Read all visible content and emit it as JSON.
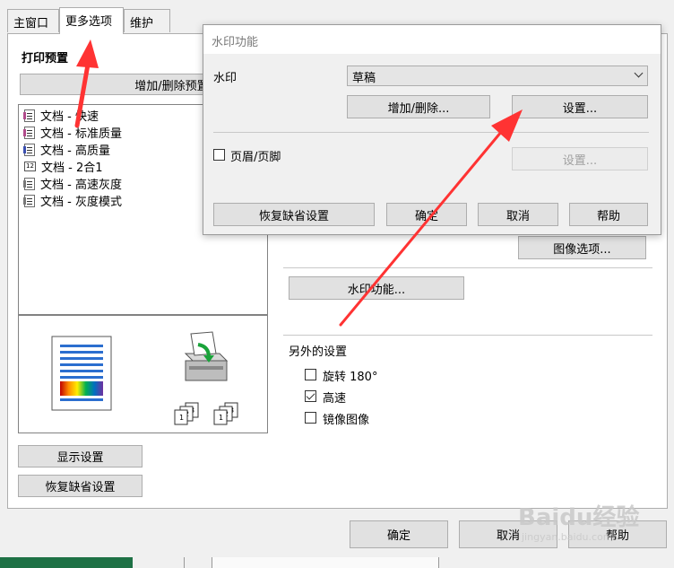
{
  "tabs": [
    "主窗口",
    "更多选项",
    "维护"
  ],
  "presets": {
    "heading": "打印预置",
    "add_remove": "增加/删除预置...",
    "items": [
      "文档 - 快速",
      "文档 - 标准质量",
      "文档 - 高质量",
      "文档 - 2合1",
      "文档 - 高速灰度",
      "文档 - 灰度模式"
    ]
  },
  "left_buttons": {
    "show_settings": "显示设置",
    "restore_defaults": "恢复缺省设置"
  },
  "right_panel": {
    "image_options": "图像选项...",
    "watermark_features": "水印功能...",
    "extra_settings_title": "另外的设置",
    "rotate_180": "旋转 180°",
    "high_speed": "高速",
    "mirror_image": "镜像图像"
  },
  "checkbox_states": {
    "rotate_180": false,
    "high_speed": true,
    "mirror_image": false,
    "header_footer": false
  },
  "footer": {
    "ok": "确定",
    "cancel": "取消",
    "help": "帮助"
  },
  "dialog": {
    "title": "水印功能",
    "watermark_label": "水印",
    "watermark_value": "草稿",
    "add_delete": "增加/删除...",
    "settings": "设置...",
    "header_footer": "页眉/页脚",
    "settings_disabled": "设置...",
    "restore_defaults": "恢复缺省设置",
    "ok": "确定",
    "cancel": "取消",
    "help": "帮助"
  },
  "watermark_logo": {
    "brand": "Baidu经验",
    "url": "jingyan.baidu.com"
  },
  "colors": {
    "annotation_arrow": "#ff3333",
    "tab_bg": "#ffffff",
    "button_bg": "#e1e1e1"
  }
}
